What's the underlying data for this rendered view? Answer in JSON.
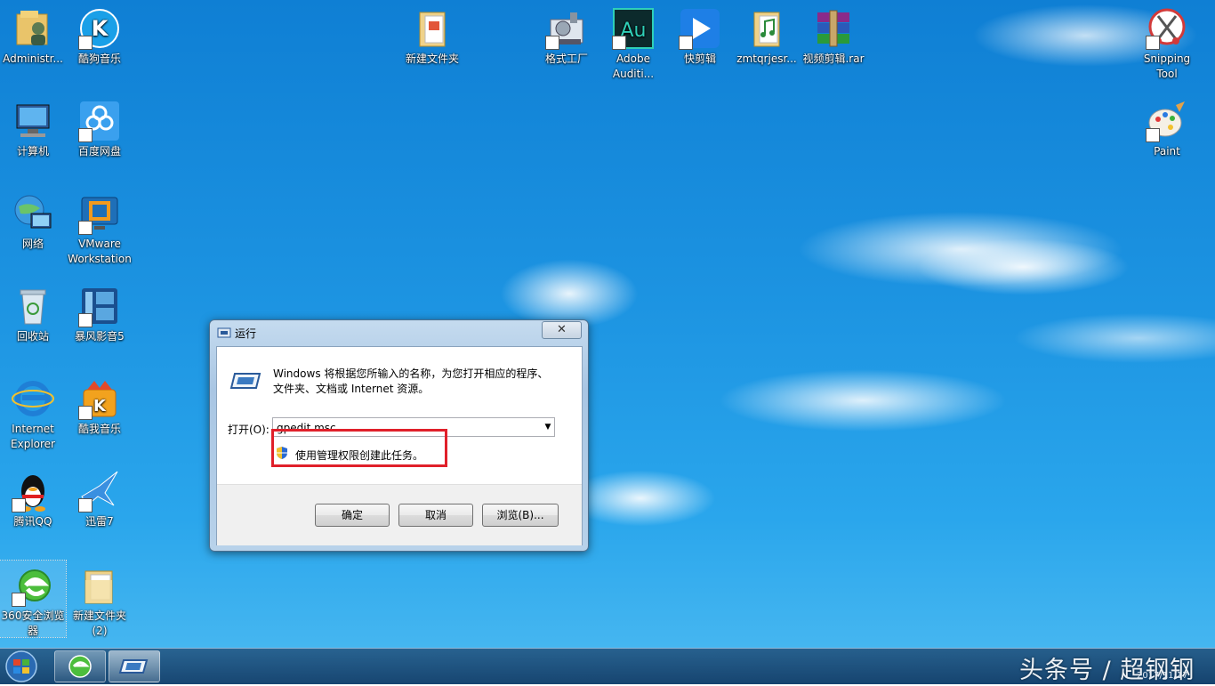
{
  "desktop": {
    "icons": {
      "administrator": "Administr...",
      "kugou_top": "酷狗音乐",
      "new_folder": "新建文件夹",
      "geshi": "格式工厂",
      "audition": "Adobe Auditi...",
      "kuaijianji": "快剪辑",
      "zmtqrjesr": "zmtqrjesr...",
      "rar": "视频剪辑.rar",
      "snipping": "Snipping Tool",
      "computer": "计算机",
      "baidu": "百度网盘",
      "paint": "Paint",
      "network": "网络",
      "vmware": "VMware Workstation",
      "recycle": "回收站",
      "baofeng": "暴风影音5",
      "ie": "Internet Explorer",
      "kugou_mid": "酷我音乐",
      "qq": "腾讯QQ",
      "xunlei": "迅雷7",
      "browser360": "360安全浏览器",
      "new_folder2": "新建文件夹 (2)"
    },
    "au_badge": "Au"
  },
  "run_dialog": {
    "title": "运行",
    "close": "✕",
    "description": "Windows 将根据您所输入的名称，为您打开相应的程序、文件夹、文档或 Internet 资源。",
    "open_label": "打开(O):",
    "open_value": "gpedit.msc",
    "admin_note": "使用管理权限创建此任务。",
    "buttons": {
      "ok": "确定",
      "cancel": "取消",
      "browse": "浏览(B)..."
    }
  },
  "taskbar": {
    "watermark": "头条号 / 超钢钢",
    "date": "2017/11/17"
  },
  "colors": {
    "highlight": "#e0202a",
    "sky": "#1c93e1"
  }
}
